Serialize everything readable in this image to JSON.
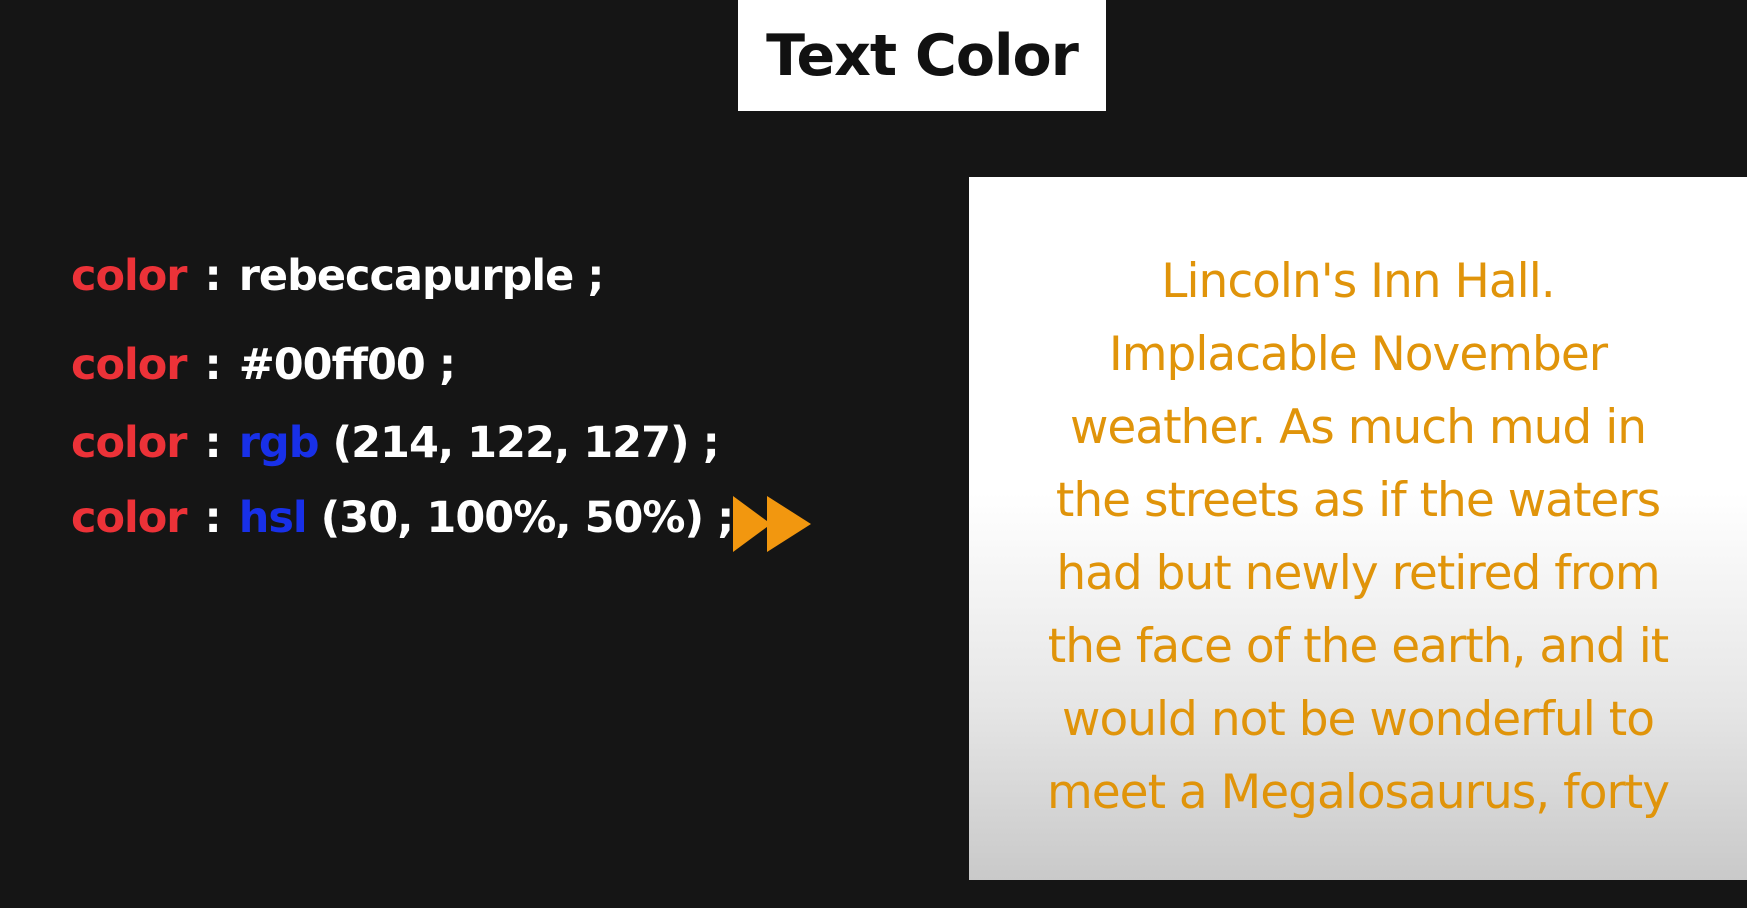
{
  "title": "Text Color",
  "code_lines": [
    {
      "prop": "color",
      "sep": ":",
      "fn": "",
      "value": "rebeccapurple",
      "end": ";"
    },
    {
      "prop": "color",
      "sep": ":",
      "fn": "",
      "value": "#00ff00",
      "end": ";"
    },
    {
      "prop": "color",
      "sep": ":",
      "fn": "rgb",
      "value": "(214, 122, 127)",
      "end": ";"
    },
    {
      "prop": "color",
      "sep": ":",
      "fn": "hsl",
      "value": "(30, 100%, 50%)",
      "end": ";"
    }
  ],
  "arrow_icon": "fast-forward-icon",
  "preview": {
    "text_color": "#e0940a",
    "lines": [
      "Lincoln's Inn Hall.",
      "Implacable November",
      "weather. As much mud in",
      "the streets as if the waters",
      "had but newly retired from",
      "the face of the earth, and it",
      "would not be wonderful to",
      "meet a Megalosaurus, forty"
    ]
  },
  "colors": {
    "background": "#151515",
    "property": "#ec3238",
    "function": "#1830e8",
    "value": "#ffffff",
    "accent": "#f2970f"
  }
}
